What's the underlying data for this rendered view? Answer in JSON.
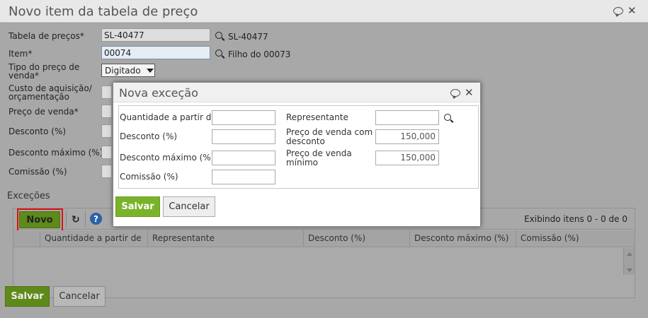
{
  "window": {
    "title": "Novo item da tabela de preço"
  },
  "form": {
    "tabela_label": "Tabela de preços*",
    "tabela_value": "SL-40477",
    "tabela_desc": "SL-40477",
    "item_label": "Item*",
    "item_value": "00074",
    "item_desc": "Filho do 00073",
    "tipo_label_1": "Tipo do preço de",
    "tipo_label_2": "venda*",
    "tipo_value": "Digitado",
    "custo_label_1": "Custo de aquisição/",
    "custo_label_2": "orçamentação",
    "preco_label": "Preço de venda*",
    "desconto_label": "Desconto (%)",
    "desconto_max_label": "Desconto máximo (%)",
    "comissao_label": "Comissão (%)"
  },
  "excecoes": {
    "label": "Exceções",
    "novo_button": "Novo",
    "help_label": "?",
    "showing_text": "Exibindo itens 0 - 0 de 0",
    "columns": [
      "Quantidade a partir de",
      "Representante",
      "Desconto (%)",
      "Desconto máximo (%)",
      "Comissão (%)"
    ]
  },
  "footer": {
    "save_label": "Salvar",
    "cancel_label": "Cancelar"
  },
  "modal": {
    "title": "Nova exceção",
    "qtd_label": "Quantidade a partir de",
    "qtd_value": "",
    "desconto_label": "Desconto (%)",
    "desconto_value": "",
    "desconto_max_label": "Desconto máximo (%)",
    "desconto_max_value": "",
    "comissao_label": "Comissão (%)",
    "comissao_value": "",
    "representante_label": "Representante",
    "representante_value": "",
    "preco_desc_label_1": "Preço de venda com",
    "preco_desc_label_2": "desconto",
    "preco_desc_value": "150,000",
    "preco_min_label_1": "Preço de venda",
    "preco_min_label_2": "mínimo",
    "preco_min_value": "150,000",
    "save_label": "Salvar",
    "cancel_label": "Cancelar"
  },
  "colors": {
    "accent_green": "#7ab32a",
    "highlight_red": "#e01010",
    "help_blue": "#2a62a8"
  }
}
